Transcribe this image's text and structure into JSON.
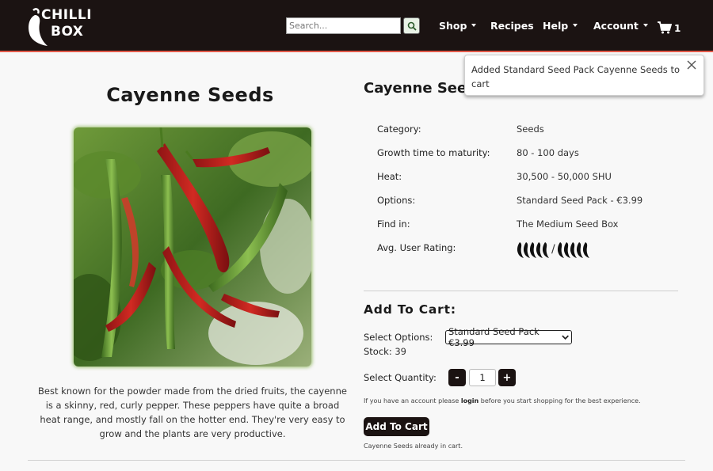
{
  "brand": {
    "line1": "CHILLI",
    "line2": "BOX"
  },
  "nav": {
    "search_placeholder": "Search...",
    "items": [
      {
        "label": "Shop",
        "dropdown": true
      },
      {
        "label": "Recipes",
        "dropdown": false
      },
      {
        "label": "Help",
        "dropdown": true
      },
      {
        "label": "Account",
        "dropdown": true
      }
    ],
    "cart_count": "1"
  },
  "toast": {
    "message": "Added Standard Seed Pack Cayenne Seeds to cart"
  },
  "product": {
    "title": "Cayenne Seeds",
    "image_alt": "cayenne-peppers-photo",
    "description": "Best known for the powder made from the dried fruits, the cayenne is a skinny, red, curly pepper. These peppers have quite a broad heat range, and mostly fall on the hotter end. They're very easy to grow and the plants are very productive."
  },
  "details": {
    "title": "Cayenne Seeds",
    "rows": [
      {
        "key": "Category:",
        "value": "Seeds"
      },
      {
        "key": "Growth time to maturity:",
        "value": "80 - 100 days"
      },
      {
        "key": "Heat:",
        "value": "30,500 - 50,000 SHU"
      },
      {
        "key": "Options:",
        "value": "Standard Seed Pack - €3.99"
      },
      {
        "key": "Find in:",
        "value": "The Medium Seed Box"
      },
      {
        "key": "Avg. User Rating:",
        "value": ""
      }
    ],
    "rating": {
      "value": 0,
      "max": 5,
      "separator": "/"
    }
  },
  "add_to_cart": {
    "title": "Add To Cart:",
    "select_label": "Select Options:",
    "select_value": "Standard Seed Pack €3.99",
    "stock_label": "Stock:",
    "stock_value": "39",
    "quantity_label": "Select Quantity:",
    "minus": "-",
    "quantity": "1",
    "plus": "+",
    "login_note_pre": "If you have an account please ",
    "login_link": "login",
    "login_note_post": " before you start shopping for the best experience.",
    "button": "Add To Cart",
    "cart_note": "Cayenne Seeds already in cart."
  },
  "colors": {
    "navbar": "#1b1312",
    "accent": "#e35a4a",
    "button": "#1b1312",
    "image_glow": "#78aa3c"
  }
}
